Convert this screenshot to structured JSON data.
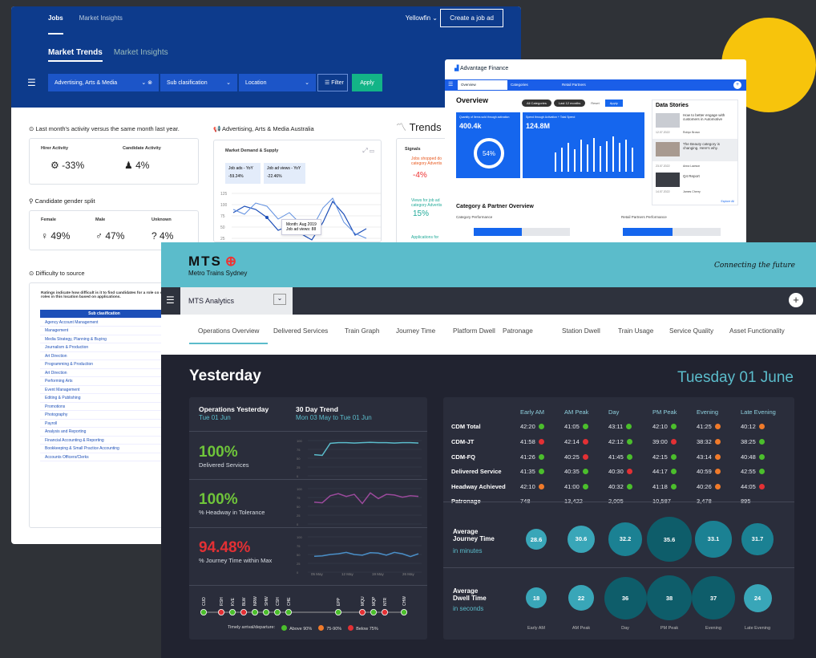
{
  "w1": {
    "nav": [
      "Jobs",
      "Market Insights"
    ],
    "user": "Yellowfin",
    "create": "Create a job ad",
    "subtabs": [
      "Market Trends",
      "Market Insights"
    ],
    "filters": [
      "Advertising, Arts & Media",
      "Sub clasification",
      "Location",
      "Filter",
      "Apply"
    ],
    "sec1": "Last month's activity versus the same month last year.",
    "hirer_label": "Hirer Activity",
    "hirer_val": "-33%",
    "cand_label": "Candidate Activity",
    "cand_val": "4%",
    "gender_title": "Candidate gender split",
    "female": "Female",
    "female_val": "49%",
    "male": "Male",
    "male_val": "47%",
    "unknown": "Unknown",
    "unknown_val": "4%",
    "difficulty": "Difficulty to source",
    "ratings": "Ratings indicate how difficult is it to find candidates for a role co other roles in this location based on applications.",
    "sub_header": "Sub clasification",
    "subs": [
      "Agency Account Management",
      "Management",
      "Media Strategy, Planning & Buying",
      "Journalism & Production",
      "Art Direction",
      "Programming & Production",
      "Art Direction",
      "Performing Arts",
      "Event Management",
      "Editing & Publishing",
      "Promotions",
      "Photography",
      "Payroll",
      "Analysis and Reporting",
      "Financial Accounting & Reporting",
      "Bookkeeping & Small Practice Accounting",
      "Accounts Officers/Clerks"
    ],
    "adv_title": "Advertising, Arts & Media Australia",
    "demand": "Market Demand & Supply",
    "jobads_lbl": "Job ads - YoY",
    "jobads_val": "-59.24%",
    "views_lbl": "Job ad views - YoY",
    "views_val": "-22.46%",
    "y_ticks": [
      "125",
      "100",
      "75",
      "50",
      "25"
    ],
    "tooltip_month": "Month: Aug 2019",
    "tooltip_views": "Job ad views: 88",
    "trends": "Trends",
    "signals": "Signals",
    "sig1": "Jobs shopped do category Advertis",
    "sig1_val": "-4%",
    "sig2": "Views for job ad category Advertis",
    "sig2_val": "15%",
    "sig3": "Applications for"
  },
  "w2": {
    "brand": "Advantage Finance",
    "nav": [
      "Overview",
      "Categories",
      "Retail Partners"
    ],
    "title": "Overview",
    "pills": [
      "All Categories",
      "Last 12 months",
      "Reset",
      "Apply"
    ],
    "k1_lbl": "Quantity of Items sold through activation",
    "k1_val": "400.4k",
    "k1_pct": "54%",
    "k2_lbl": "Spend through Activation + Total Spend",
    "k2_val": "124.8M",
    "stories": "Data Stories",
    "story1": "How to better engage with customers in Automotive",
    "s1_date": "12.07.2022",
    "s1_author": "Robyn Brown",
    "story2": "The Beauty category is changing. Here's why.",
    "s2_date": "23.07.2022",
    "s2_author": "Anna Lawson",
    "story3": "Q4 Report",
    "s3_date": "14.07.2022",
    "s3_author": "James Cherry",
    "explore": "Explore All",
    "cat_title": "Category & Partner Overview",
    "cat_perf": "Category Performance",
    "ret_perf": "Retail Partners Performance"
  },
  "w3": {
    "logo": "MTS",
    "logo_sub": "Metro Trains Sydney",
    "tagline": "Connecting the future",
    "select": "MTS Analytics",
    "tabs": [
      "Operations Overview",
      "Delivered Services",
      "Train Graph",
      "Journey Time",
      "Platform Dwell",
      "Patronage",
      "Station Dwell",
      "Train Usage",
      "Service Quality",
      "Asset Functionality"
    ],
    "yesterday": "Yesterday",
    "date": "Tuesday 01 June",
    "ops_title": "Operations Yesterday",
    "ops_date": "Tue 01 Jun",
    "trend_title": "30 Day Trend",
    "trend_date": "Mon 03 May to Tue 01 Jun",
    "m1": "100%",
    "m1_lbl": "Delivered Services",
    "m2": "100%",
    "m2_lbl": "% Headway in Tolerance",
    "m3": "94.48%",
    "m3_lbl": "% Journey Time within Max",
    "spark_y": [
      "100",
      "75",
      "50",
      "25",
      "0"
    ],
    "spark_x": [
      "05 May",
      "12 May",
      "19 May",
      "26 May"
    ],
    "stations": [
      "CUD",
      "RSH",
      "KVE",
      "BLW",
      "NRW",
      "SHW",
      "CSH",
      "CHE",
      "EPP",
      "MQU",
      "MQP",
      "NTR",
      "CHW"
    ],
    "legend": [
      "Timely arrival/departure:",
      "Above 90%",
      "75-90%",
      "Below 75%"
    ],
    "cols": [
      "Early AM",
      "AM Peak",
      "Day",
      "PM Peak",
      "Evening",
      "Late Evening"
    ],
    "rows": [
      {
        "name": "CDM Total",
        "vals": [
          "42:20",
          "41:05",
          "43:11",
          "42:10",
          "41:25",
          "40:12"
        ],
        "st": [
          "g",
          "g",
          "g",
          "g",
          "o",
          "o"
        ]
      },
      {
        "name": "CDM-JT",
        "vals": [
          "41:58",
          "42:14",
          "42:12",
          "39:00",
          "38:32",
          "38:25"
        ],
        "st": [
          "r",
          "r",
          "g",
          "r",
          "o",
          "g"
        ]
      },
      {
        "name": "CDM-FQ",
        "vals": [
          "41:26",
          "40:25",
          "41:45",
          "42:15",
          "43:14",
          "40:48"
        ],
        "st": [
          "g",
          "r",
          "g",
          "g",
          "o",
          "g"
        ]
      },
      {
        "name": "Delivered Service",
        "vals": [
          "41:35",
          "40:35",
          "40:30",
          "44:17",
          "40:59",
          "42:55"
        ],
        "st": [
          "g",
          "g",
          "r",
          "g",
          "o",
          "g"
        ]
      },
      {
        "name": "Headway Achieved",
        "vals": [
          "42:10",
          "41:00",
          "40:32",
          "41:18",
          "40:26",
          "44:05"
        ],
        "st": [
          "o",
          "g",
          "g",
          "g",
          "o",
          "r"
        ]
      },
      {
        "name": "Patronage",
        "vals": [
          "748",
          "13,422",
          "2,005",
          "10,587",
          "3,478",
          "895"
        ],
        "st": [
          "",
          "",
          "",
          "",
          "",
          ""
        ]
      }
    ],
    "journey_title": "Average Journey Time",
    "journey_unit": "in minutes",
    "journey": [
      "28.6",
      "30.6",
      "32.2",
      "35.6",
      "33.1",
      "31.7"
    ],
    "dwell_title": "Average Dwell Time",
    "dwell_unit": "in seconds",
    "dwell": [
      "18",
      "22",
      "36",
      "38",
      "37",
      "24"
    ],
    "bottom": [
      "Early AM",
      "AM Peak",
      "Day",
      "PM Peak",
      "Evening",
      "Late Evening"
    ]
  },
  "colors": {
    "green": "#4bbe2c",
    "orange": "#f07a2a",
    "red": "#e33034",
    "teal": "#5bbccb"
  }
}
